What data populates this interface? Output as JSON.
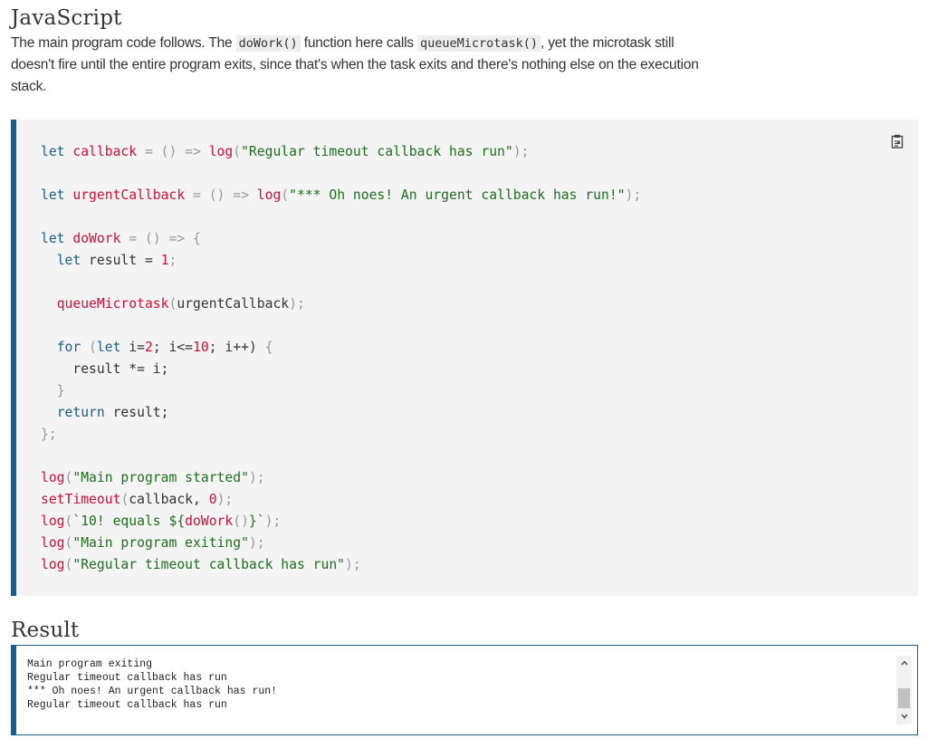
{
  "javascript_heading": "JavaScript",
  "description": {
    "part1": "The main program code follows. The ",
    "code1": "doWork()",
    "part2": " function here calls ",
    "code2": "queueMicrotask()",
    "part3": ", yet the microtask still doesn't fire until the entire program exits, since that's when the task exits and there's nothing else on the execution stack."
  },
  "code": {
    "l1": {
      "kw": "let",
      "name": "callback",
      "eq": " = () => ",
      "fn": "log",
      "p1": "(",
      "str": "\"Regular timeout callback has run\"",
      "p2": ");"
    },
    "l2": {
      "kw": "let",
      "name": "urgentCallback",
      "eq": " = () => ",
      "fn": "log",
      "p1": "(",
      "str": "\"*** Oh noes! An urgent callback has run!\"",
      "p2": ");"
    },
    "l3": {
      "kw": "let",
      "name": "doWork",
      "eq": " = () => ",
      "brace": "{"
    },
    "l4": {
      "kw": "let",
      "rest": " result = ",
      "num": "1",
      "semi": ";"
    },
    "l5": {
      "fn": "queueMicrotask",
      "p1": "(",
      "arg": "urgentCallback",
      "p2": ");"
    },
    "l6": {
      "kw": "for",
      "p1": " (",
      "kw2": "let",
      "a": " i=",
      "n1": "2",
      "b": "; i<=",
      "n2": "10",
      "c": "; i++) ",
      "brace": "{"
    },
    "l7": {
      "text": "result *= i;"
    },
    "l8": {
      "brace": "}"
    },
    "l9": {
      "kw": "return",
      "rest": " result;"
    },
    "l10": {
      "text": "};"
    },
    "l11": {
      "fn": "log",
      "p1": "(",
      "str": "\"Main program started\"",
      "p2": ");"
    },
    "l12": {
      "fn": "setTimeout",
      "p1": "(",
      "arg": "callback, ",
      "num": "0",
      "p2": ");"
    },
    "l13": {
      "fn": "log",
      "p1": "(",
      "str1": "`10! equals ${",
      "fn2": "doWork",
      "p3": "()",
      "str2": "}`",
      "p2": ");"
    },
    "l14": {
      "fn": "log",
      "p1": "(",
      "str": "\"Main program exiting\"",
      "p2": ");"
    },
    "l15": {
      "fn": "log",
      "p1": "(",
      "str": "\"Regular timeout callback has run\"",
      "p2": ");"
    }
  },
  "copy_icon": "clipboard-icon",
  "result_heading": "Result",
  "result_lines": [
    "Main program exiting",
    "Regular timeout callback has run",
    "*** Oh noes! An urgent callback has run!",
    "Regular timeout callback has run"
  ],
  "colors": {
    "accent": "#1b5e8a",
    "keyword": "#1b5e8a",
    "function": "#d20f39",
    "string": "#1e6e1e",
    "code_bg": "#f4f4f4"
  }
}
